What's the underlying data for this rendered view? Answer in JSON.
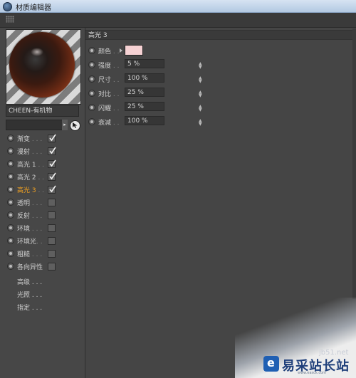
{
  "window": {
    "title": "材质编辑器"
  },
  "material": {
    "name": "CHEEN-有机物"
  },
  "channels": [
    {
      "label": "渐变",
      "dots": " . . .",
      "checked": true,
      "active": false
    },
    {
      "label": "漫射",
      "dots": " . . .",
      "checked": true,
      "active": false
    },
    {
      "label": "高光 1",
      "dots": " . .",
      "checked": true,
      "active": false
    },
    {
      "label": "高光 2",
      "dots": " . .",
      "checked": true,
      "active": false
    },
    {
      "label": "高光 3",
      "dots": " . .",
      "checked": true,
      "active": true
    },
    {
      "label": "透明",
      "dots": " . . .",
      "checked": false,
      "active": false
    },
    {
      "label": "反射",
      "dots": " . . .",
      "checked": false,
      "active": false
    },
    {
      "label": "环境",
      "dots": " . . .",
      "checked": false,
      "active": false
    },
    {
      "label": "环境光",
      "dots": ". .",
      "checked": false,
      "active": false
    },
    {
      "label": "粗糙",
      "dots": " . . .",
      "checked": false,
      "active": false
    },
    {
      "label": "各向异性",
      "dots": "",
      "checked": false,
      "active": false
    }
  ],
  "extra_items": [
    {
      "label": "高级 . . ."
    },
    {
      "label": "光照 . . ."
    },
    {
      "label": "指定 . . ."
    }
  ],
  "section": {
    "title": "高光 3"
  },
  "params": {
    "color": {
      "label": "颜色",
      "dots": " . .",
      "value": "#f6d2d4"
    },
    "rows": [
      {
        "label": "强度",
        "dots": " . .",
        "value": "5 %"
      },
      {
        "label": "尺寸",
        "dots": " . .",
        "value": "100 %"
      },
      {
        "label": "对比",
        "dots": " . .",
        "value": "25 %"
      },
      {
        "label": "闪耀",
        "dots": " . .",
        "value": "25 %"
      },
      {
        "label": "衰减",
        "dots": " . .",
        "value": "100 %"
      }
    ]
  },
  "watermark": {
    "brand": "易采站长站",
    "url": "www.easck.com",
    "small": "jb51.net"
  },
  "colors": {
    "accent": "#f0a020",
    "panel": "#454545"
  }
}
